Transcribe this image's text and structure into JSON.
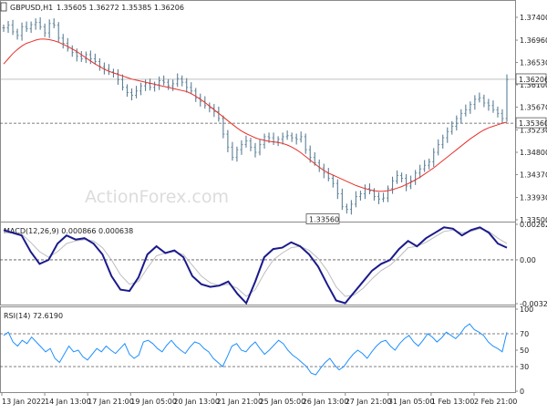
{
  "chart_data": [
    {
      "type": "candlestick",
      "symbol_label": "GBPUSD,H1",
      "ohlc_header": "1.35605 1.36272 1.35385 1.36206",
      "y_ticks": [
        "1.37400",
        "1.36960",
        "1.36530",
        "1.36100",
        "1.35670",
        "1.35230",
        "1.34800",
        "1.34370",
        "1.33930",
        "1.33500"
      ],
      "ylim": [
        1.335,
        1.374
      ],
      "last_price_label": "1.36206",
      "last_price": 1.36206,
      "level_label": "1.35360",
      "level": 1.3536,
      "low_label": "1.33560",
      "low": 1.3356,
      "watermark": "ActionForex.com",
      "price_color": "#5b7f95",
      "ma_color": "#e8302a",
      "close_series": [
        1.372,
        1.3725,
        1.3712,
        1.3705,
        1.3722,
        1.3718,
        1.3726,
        1.373,
        1.3722,
        1.371,
        1.3728,
        1.3725,
        1.37,
        1.369,
        1.368,
        1.3672,
        1.3665,
        1.366,
        1.3668,
        1.366,
        1.3655,
        1.3645,
        1.364,
        1.3635,
        1.3632,
        1.362,
        1.3605,
        1.3595,
        1.359,
        1.3598,
        1.3608,
        1.3612,
        1.3605,
        1.361,
        1.3618,
        1.3615,
        1.3608,
        1.3612,
        1.3622,
        1.3615,
        1.3605,
        1.3598,
        1.3585,
        1.3578,
        1.357,
        1.3565,
        1.3558,
        1.3545,
        1.3515,
        1.349,
        1.347,
        1.3485,
        1.3495,
        1.3502,
        1.349,
        1.348,
        1.3495,
        1.351,
        1.3508,
        1.35,
        1.3505,
        1.351,
        1.3512,
        1.3508,
        1.3505,
        1.351,
        1.3485,
        1.347,
        1.346,
        1.345,
        1.344,
        1.343,
        1.342,
        1.34,
        1.3375,
        1.337,
        1.338,
        1.3395,
        1.34,
        1.341,
        1.3405,
        1.3395,
        1.339,
        1.3392,
        1.341,
        1.3425,
        1.3435,
        1.343,
        1.3415,
        1.3425,
        1.344,
        1.3448,
        1.3455,
        1.3462,
        1.348,
        1.3495,
        1.3508,
        1.352,
        1.353,
        1.3545,
        1.3555,
        1.3562,
        1.3572,
        1.3582,
        1.3585,
        1.3575,
        1.357,
        1.3562,
        1.3555,
        1.3545,
        1.362
      ],
      "ma_series": [
        1.365,
        1.366,
        1.367,
        1.3678,
        1.3685,
        1.369,
        1.3693,
        1.3696,
        1.3698,
        1.3698,
        1.3697,
        1.3695,
        1.3692,
        1.3688,
        1.3684,
        1.3679,
        1.3674,
        1.3668,
        1.3662,
        1.3656,
        1.365,
        1.3645,
        1.364,
        1.3636,
        1.3633,
        1.363,
        1.3627,
        1.3624,
        1.3621,
        1.3619,
        1.3617,
        1.3615,
        1.3613,
        1.3611,
        1.3609,
        1.3607,
        1.3605,
        1.3603,
        1.3601,
        1.3599,
        1.3597,
        1.3593,
        1.3588,
        1.3582,
        1.3576,
        1.3569,
        1.3562,
        1.3555,
        1.3548,
        1.3541,
        1.3534,
        1.3527,
        1.3521,
        1.3516,
        1.3512,
        1.3508,
        1.3505,
        1.3503,
        1.3501,
        1.35,
        1.3499,
        1.3497,
        1.3494,
        1.349,
        1.3485,
        1.3479,
        1.3472,
        1.3465,
        1.3458,
        1.3451,
        1.3445,
        1.344,
        1.3436,
        1.3432,
        1.3428,
        1.3424,
        1.342,
        1.3416,
        1.3413,
        1.341,
        1.3408,
        1.3406,
        1.3405,
        1.3405,
        1.3406,
        1.3408,
        1.3411,
        1.3414,
        1.3418,
        1.3422,
        1.3427,
        1.3432,
        1.3438,
        1.3444,
        1.345,
        1.3457,
        1.3464,
        1.3471,
        1.3478,
        1.3485,
        1.3492,
        1.3499,
        1.3506,
        1.3512,
        1.3518,
        1.3523,
        1.3527,
        1.353,
        1.3533,
        1.3536,
        1.3538
      ]
    },
    {
      "type": "line",
      "label": "MACD(12,26,9) 0.000866 0.000638",
      "y_ticks": [
        "0.002624",
        "0.00",
        "-0.003237"
      ],
      "ylim": [
        -0.003237,
        0.002624
      ],
      "macd_color": "#1a1a8c",
      "signal_color": "#bdbdbd",
      "macd_series": [
        0.0022,
        0.002,
        0.0018,
        0.0006,
        -0.0003,
        0.0,
        0.0012,
        0.0018,
        0.0015,
        0.0016,
        0.0012,
        0.0004,
        -0.0012,
        -0.0022,
        -0.0023,
        -0.0013,
        0.0004,
        0.001,
        0.0005,
        0.0007,
        0.0002,
        -0.0012,
        -0.0018,
        -0.002,
        -0.0019,
        -0.0016,
        -0.0025,
        -0.0032,
        -0.0016,
        0.0002,
        0.0008,
        0.0009,
        0.0013,
        0.001,
        0.0004,
        -0.0005,
        -0.0018,
        -0.003,
        -0.0032,
        -0.0024,
        -0.0016,
        -0.0008,
        -0.0003,
        0.0,
        0.0008,
        0.0014,
        0.001,
        0.0016,
        0.002,
        0.0024,
        0.0023,
        0.0018,
        0.0022,
        0.0024,
        0.002,
        0.0012,
        0.0009
      ],
      "signal_series": [
        0.002,
        0.002,
        0.0019,
        0.0013,
        0.0006,
        0.0002,
        0.0006,
        0.0012,
        0.0014,
        0.0015,
        0.0014,
        0.0009,
        0.0,
        -0.0011,
        -0.0018,
        -0.0016,
        -0.0006,
        0.0003,
        0.0005,
        0.0006,
        0.0004,
        -0.0004,
        -0.0012,
        -0.0017,
        -0.0019,
        -0.0018,
        -0.0021,
        -0.0027,
        -0.0022,
        -0.001,
        0.0,
        0.0005,
        0.0009,
        0.001,
        0.0007,
        0.0001,
        -0.0008,
        -0.002,
        -0.0027,
        -0.0026,
        -0.0021,
        -0.0014,
        -0.0008,
        -0.0004,
        0.0002,
        0.0009,
        0.001,
        0.0013,
        0.0017,
        0.0021,
        0.0022,
        0.002,
        0.0021,
        0.0023,
        0.0021,
        0.0016,
        0.0012
      ]
    },
    {
      "type": "line",
      "label": "RSI(14) 72.6190",
      "y_ticks": [
        "100",
        "70",
        "50",
        "30",
        "0"
      ],
      "ylim": [
        0,
        100
      ],
      "level_lines": [
        70,
        30
      ],
      "rsi_color": "#1e90ff",
      "rsi_series": [
        68,
        72,
        60,
        55,
        62,
        58,
        66,
        60,
        54,
        48,
        52,
        40,
        35,
        45,
        55,
        48,
        50,
        42,
        38,
        45,
        52,
        48,
        55,
        50,
        46,
        52,
        58,
        45,
        40,
        44,
        60,
        62,
        58,
        52,
        48,
        56,
        62,
        55,
        50,
        46,
        54,
        60,
        58,
        52,
        48,
        40,
        35,
        30,
        42,
        55,
        58,
        50,
        48,
        55,
        60,
        52,
        45,
        50,
        56,
        62,
        58,
        50,
        44,
        40,
        35,
        30,
        22,
        20,
        28,
        35,
        40,
        32,
        26,
        30,
        38,
        45,
        50,
        46,
        40,
        48,
        55,
        60,
        62,
        55,
        50,
        58,
        64,
        68,
        60,
        55,
        62,
        70,
        66,
        60,
        65,
        72,
        68,
        64,
        70,
        78,
        82,
        75,
        72,
        68,
        60,
        55,
        52,
        48,
        72
      ]
    }
  ],
  "x_ticks": [
    "13 Jan 2022",
    "14 Jan 13:00",
    "17 Jan 21:00",
    "19 Jan 05:00",
    "20 Jan 13:00",
    "21 Jan 21:00",
    "25 Jan 05:00",
    "26 Jan 13:00",
    "27 Jan 21:00",
    "31 Jan 05:00",
    "1 Feb 13:00",
    "2 Feb 21:00"
  ]
}
